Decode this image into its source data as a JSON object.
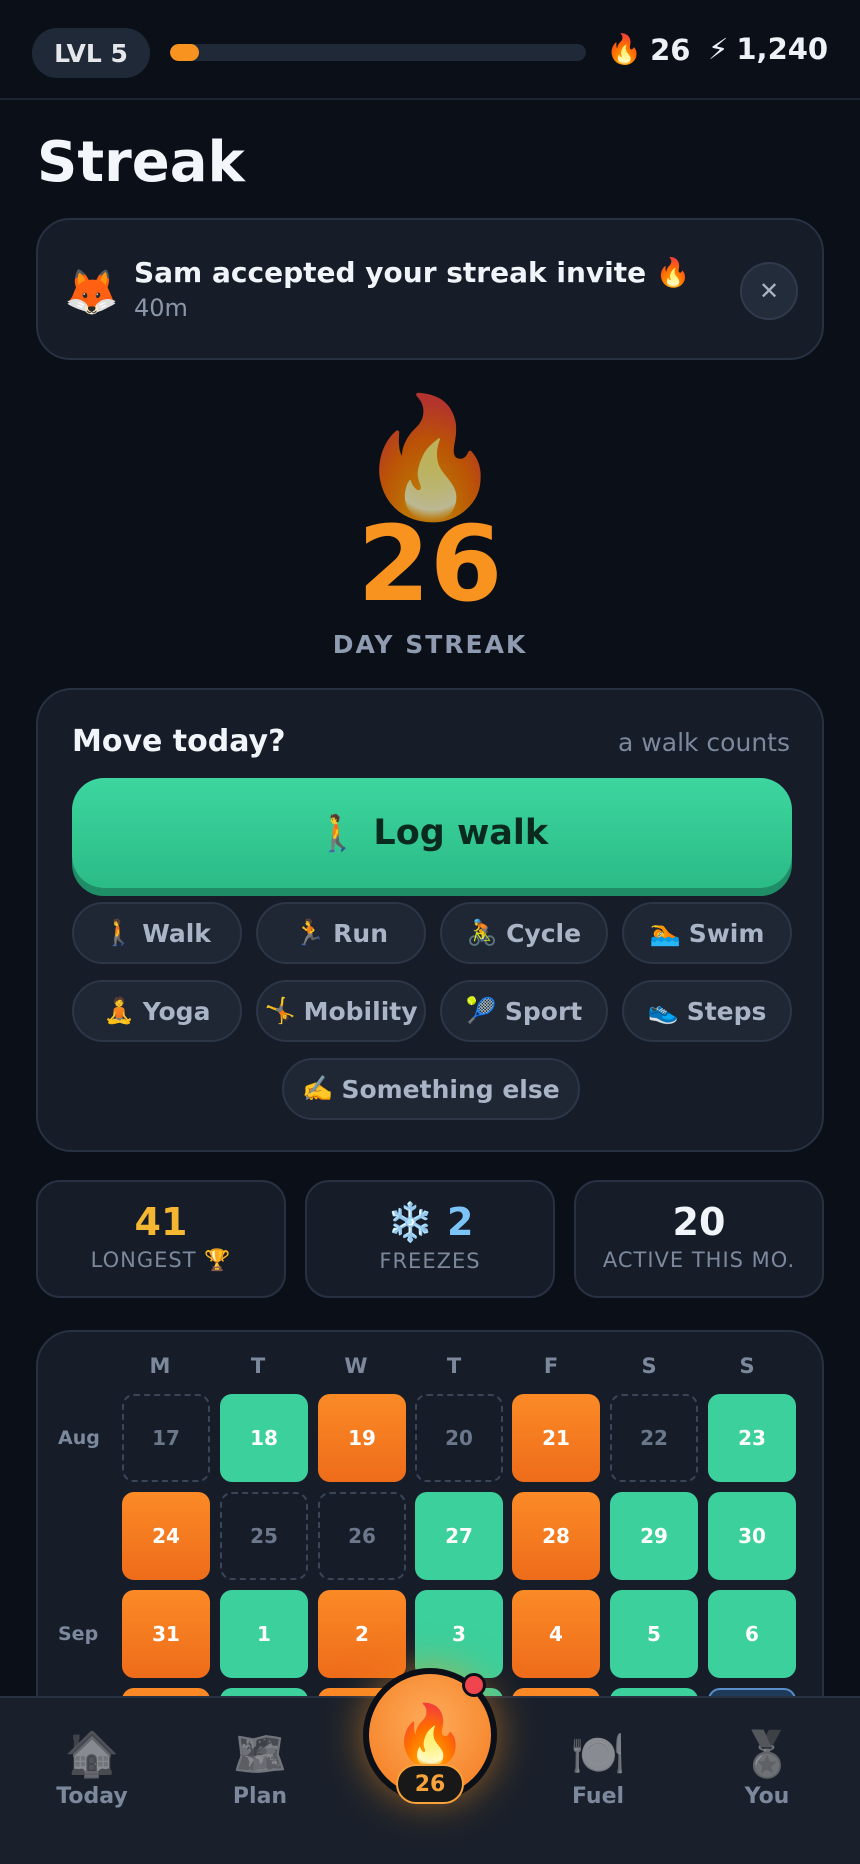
{
  "topbar": {
    "level": "LVL 5",
    "xp_progress": 0.07,
    "streak_icon": "🔥",
    "streak_count": "26",
    "points_icon": "⚡",
    "points": "1,240"
  },
  "page_title": "Streak",
  "notification": {
    "avatar": "🦊",
    "message": "Sam accepted your streak invite 🔥",
    "time": "40m",
    "close_icon": "✕"
  },
  "hero": {
    "flame": "🔥",
    "count": "26",
    "label": "DAY STREAK"
  },
  "move_card": {
    "question": "Move today?",
    "hint": "a walk counts",
    "log_icon": "🚶",
    "log_label": "Log walk",
    "activities": [
      {
        "icon": "🚶",
        "label": "Walk"
      },
      {
        "icon": "🏃",
        "label": "Run"
      },
      {
        "icon": "🚴",
        "label": "Cycle"
      },
      {
        "icon": "🏊",
        "label": "Swim"
      },
      {
        "icon": "🧘",
        "label": "Yoga"
      },
      {
        "icon": "🤸",
        "label": "Mobility"
      },
      {
        "icon": "🎾",
        "label": "Sport"
      },
      {
        "icon": "👟",
        "label": "Steps"
      },
      {
        "icon": "✍️",
        "label": "Something else"
      }
    ]
  },
  "stats": {
    "longest_value": "41",
    "longest_label": "LONGEST 🏆",
    "freezes_value": "❄️ 2",
    "freezes_label": "FREEZES",
    "active_value": "20",
    "active_label": "ACTIVE THIS MO."
  },
  "calendar": {
    "weekdays": [
      "M",
      "T",
      "W",
      "T",
      "F",
      "S",
      "S"
    ],
    "month_aug": "Aug",
    "month_sep": "Sep",
    "weeks": [
      [
        "17",
        "18",
        "19",
        "20",
        "21",
        "22",
        "23"
      ],
      [
        "24",
        "25",
        "26",
        "27",
        "28",
        "29",
        "30"
      ],
      [
        "31",
        "1",
        "2",
        "3",
        "4",
        "5",
        "6"
      ]
    ]
  },
  "nav": {
    "today_icon": "🏠",
    "today": "Today",
    "plan_icon": "🗺️",
    "plan": "Plan",
    "fab_icon": "🔥",
    "fab_badge": "26",
    "fuel_icon": "🍽️",
    "fuel": "Fuel",
    "you_icon": "🏅",
    "you": "You"
  },
  "colors": {
    "accent_orange": "#f7931e",
    "walk_green": "#3cd09d",
    "freeze_blue": "#7cc3f7",
    "background": "#0b0f17"
  }
}
